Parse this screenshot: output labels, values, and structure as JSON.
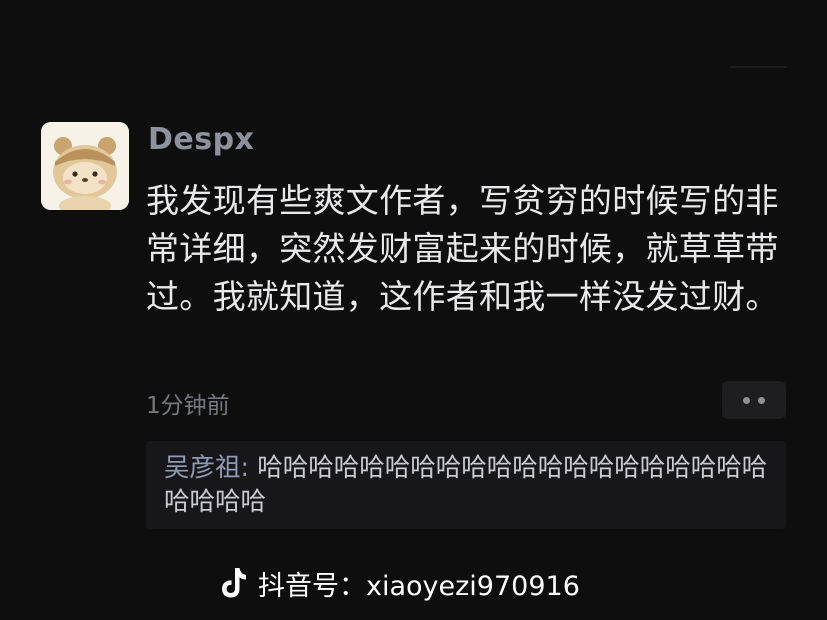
{
  "comment": {
    "username": "Despx",
    "avatar_icon": "cartoon-bear-avatar",
    "text": "我发现有些爽文作者，写贫穷的时候写的非常详细，突然发财富起来的时候，就草草带过。我就知道，这作者和我一样没发过财。",
    "timestamp": "1分钟前",
    "more_icon": "ellipsis-icon"
  },
  "reply": {
    "name": "吴彦祖:",
    "text": " 哈哈哈哈哈哈哈哈哈哈哈哈哈哈哈哈哈哈哈哈哈哈哈哈"
  },
  "watermark": {
    "icon": "douyin-logo-icon",
    "text": "抖音号：xiaoyezi970916"
  },
  "colors": {
    "background": "#0e0e0f",
    "username": "#8d929e",
    "reply_name": "#8d9bb5",
    "comment_text": "#e9e9eb"
  }
}
